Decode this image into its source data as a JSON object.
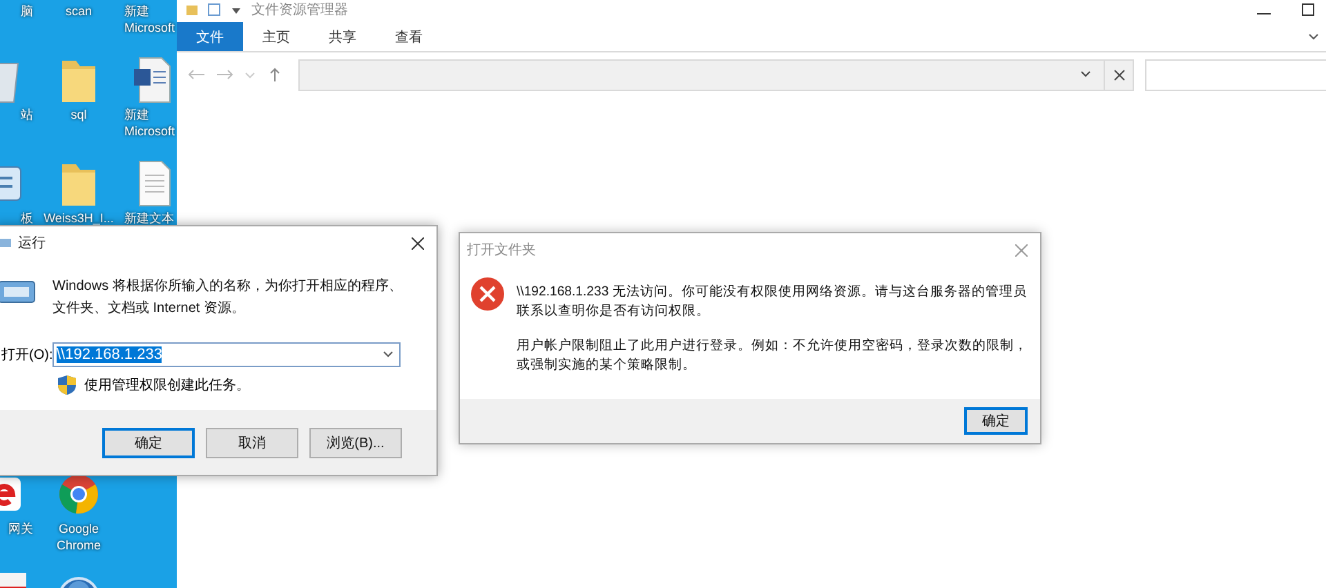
{
  "desktop": {
    "columns": [
      [
        {
          "kind": "blank",
          "label": "脑"
        },
        {
          "kind": "recycle",
          "label": "站"
        },
        {
          "kind": "panel",
          "label": "板"
        },
        {
          "kind": "ie",
          "label": "网关"
        },
        {
          "kind": "app"
        }
      ],
      [
        {
          "kind": "blank",
          "label": "scan"
        },
        {
          "kind": "folder",
          "label": "sql"
        },
        {
          "kind": "folder",
          "label": "Weiss3H_I..."
        },
        {
          "kind": "chrome",
          "label": "Google Chrome"
        },
        {
          "kind": "cp"
        }
      ],
      [
        {
          "kind": "blank",
          "label": "新建 Microsoft"
        },
        {
          "kind": "word",
          "label": "新建 Microsoft"
        },
        {
          "kind": "document",
          "label": "新建文本"
        }
      ]
    ]
  },
  "explorer": {
    "title": "文件资源管理器",
    "tabs": [
      {
        "label": "文件",
        "selected": true
      },
      {
        "label": "主页",
        "selected": false
      },
      {
        "label": "共享",
        "selected": false
      },
      {
        "label": "查看",
        "selected": false
      }
    ]
  },
  "run_dialog": {
    "title": "运行",
    "description": "Windows 将根据你所输入的名称，为你打开相应的程序、文件夹、文档或 Internet 资源。",
    "open_label": "打开(O):",
    "value": "\\\\192.168.1.233",
    "value_selected": true,
    "admin_note": "使用管理权限创建此任务。",
    "buttons": [
      {
        "label": "确定",
        "default": true
      },
      {
        "label": "取消",
        "default": false
      },
      {
        "label": "浏览(B)...",
        "default": false
      }
    ]
  },
  "error_dialog": {
    "title": "打开文件夹",
    "paragraphs": [
      "\\\\192.168.1.233 无法访问。你可能没有权限使用网络资源。请与这台服务器的管理员联系以查明你是否有访问权限。",
      "用户帐户限制阻止了此用户进行登录。例如：不允许使用空密码，登录次数的限制，或强制实施的某个策略限制。"
    ],
    "buttons": [
      {
        "label": "确定",
        "default": true
      }
    ]
  }
}
